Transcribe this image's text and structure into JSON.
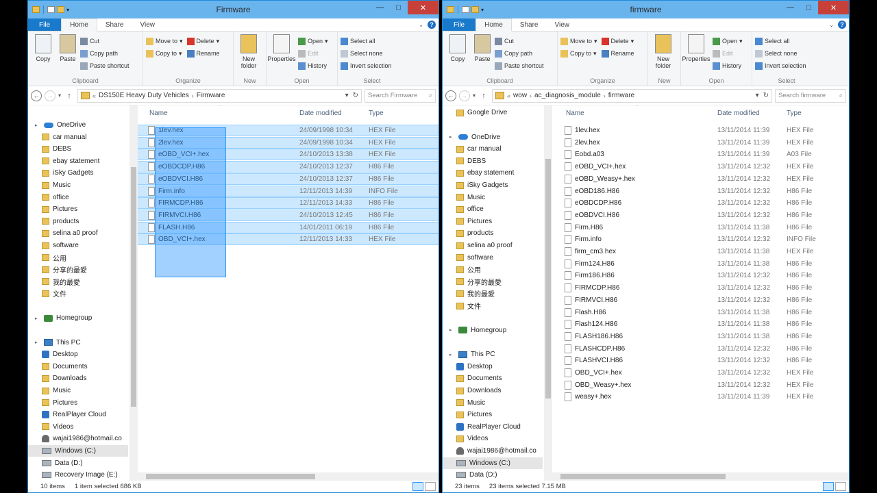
{
  "ribbon": {
    "tabs": [
      "File",
      "Home",
      "Share",
      "View"
    ],
    "clipboard": {
      "copy": "Copy",
      "paste": "Paste",
      "cut": "Cut",
      "copy_path": "Copy path",
      "paste_shortcut": "Paste shortcut",
      "label": "Clipboard"
    },
    "organize": {
      "move_to": "Move to",
      "copy_to": "Copy to",
      "delete": "Delete",
      "rename": "Rename",
      "label": "Organize"
    },
    "new": {
      "new_folder": "New folder",
      "label": "New"
    },
    "open": {
      "properties": "Properties",
      "open": "Open",
      "edit": "Edit",
      "history": "History",
      "label": "Open"
    },
    "select": {
      "select_all": "Select all",
      "select_none": "Select none",
      "invert": "Invert selection",
      "label": "Select"
    }
  },
  "columns": {
    "name": "Name",
    "date": "Date modified",
    "type": "Type"
  },
  "left": {
    "title": "Firmware",
    "breadcrumb": [
      "DS150E Heavy Duty Vehicles",
      "Firmware"
    ],
    "search_placeholder": "Search Firmware",
    "nav": [
      {
        "label": "OneDrive",
        "icon": "cloud-icon",
        "kind": "root"
      },
      {
        "label": "car manual",
        "icon": "folder-icon"
      },
      {
        "label": "DEBS",
        "icon": "folder-icon"
      },
      {
        "label": "ebay statement",
        "icon": "folder-icon"
      },
      {
        "label": "iSky Gadgets",
        "icon": "folder-icon"
      },
      {
        "label": "Music",
        "icon": "folder-icon"
      },
      {
        "label": "office",
        "icon": "folder-icon"
      },
      {
        "label": "Pictures",
        "icon": "folder-icon"
      },
      {
        "label": "products",
        "icon": "folder-icon"
      },
      {
        "label": "selina a0 proof",
        "icon": "folder-icon"
      },
      {
        "label": "software",
        "icon": "folder-icon"
      },
      {
        "label": "公用",
        "icon": "folder-icon"
      },
      {
        "label": "分享的最愛",
        "icon": "folder-icon"
      },
      {
        "label": "我的最愛",
        "icon": "folder-icon"
      },
      {
        "label": "文件",
        "icon": "folder-icon"
      },
      {
        "label": "Homegroup",
        "icon": "homegroup-icon",
        "kind": "root"
      },
      {
        "label": "This PC",
        "icon": "pc-icon",
        "kind": "root"
      },
      {
        "label": "Desktop",
        "icon": "desktop-icon"
      },
      {
        "label": "Documents",
        "icon": "folder-icon"
      },
      {
        "label": "Downloads",
        "icon": "folder-icon"
      },
      {
        "label": "Music",
        "icon": "folder-icon"
      },
      {
        "label": "Pictures",
        "icon": "folder-icon"
      },
      {
        "label": "RealPlayer Cloud",
        "icon": "realplayer-icon"
      },
      {
        "label": "Videos",
        "icon": "folder-icon"
      },
      {
        "label": "wajai1986@hotmail.co",
        "icon": "user-icon"
      },
      {
        "label": "Windows (C:)",
        "icon": "drive-icon",
        "selected": true
      },
      {
        "label": "Data (D:)",
        "icon": "drive-icon"
      },
      {
        "label": "Recovery Image (E:)",
        "icon": "drive-icon"
      }
    ],
    "files": [
      {
        "name": "1lev.hex",
        "date": "24/09/1998 10:34",
        "type": "HEX File"
      },
      {
        "name": "2lev.hex",
        "date": "24/09/1998 10:34",
        "type": "HEX File"
      },
      {
        "name": "eOBD_VCI+.hex",
        "date": "24/10/2013 13:38",
        "type": "HEX File"
      },
      {
        "name": "eOBDCDP.H86",
        "date": "24/10/2013 12:37",
        "type": "H86 File"
      },
      {
        "name": "eOBDVCI.H86",
        "date": "24/10/2013 12:37",
        "type": "H86 File"
      },
      {
        "name": "Firm.info",
        "date": "12/11/2013 14:39",
        "type": "INFO File"
      },
      {
        "name": "FIRMCDP.H86",
        "date": "12/11/2013 14:33",
        "type": "H86 File"
      },
      {
        "name": "FIRMVCI.H86",
        "date": "24/10/2013 12:45",
        "type": "H86 File"
      },
      {
        "name": "FLASH.H86",
        "date": "14/01/2011 06:19",
        "type": "H86 File"
      },
      {
        "name": "OBD_VCI+.hex",
        "date": "12/11/2013 14:33",
        "type": "HEX File"
      }
    ],
    "status": {
      "items": "10 items",
      "selected": "1 item selected  686 KB"
    }
  },
  "right": {
    "title": "firmware",
    "breadcrumb": [
      "wow",
      "ac_diagnosis_module",
      "firmware"
    ],
    "search_placeholder": "Search firmware",
    "nav": [
      {
        "label": "Google Drive",
        "icon": "folder-icon"
      },
      {
        "label": "OneDrive",
        "icon": "cloud-icon",
        "kind": "root"
      },
      {
        "label": "car manual",
        "icon": "folder-icon"
      },
      {
        "label": "DEBS",
        "icon": "folder-icon"
      },
      {
        "label": "ebay statement",
        "icon": "folder-icon"
      },
      {
        "label": "iSky Gadgets",
        "icon": "folder-icon"
      },
      {
        "label": "Music",
        "icon": "folder-icon"
      },
      {
        "label": "office",
        "icon": "folder-icon"
      },
      {
        "label": "Pictures",
        "icon": "folder-icon"
      },
      {
        "label": "products",
        "icon": "folder-icon"
      },
      {
        "label": "selina a0 proof",
        "icon": "folder-icon"
      },
      {
        "label": "software",
        "icon": "folder-icon"
      },
      {
        "label": "公用",
        "icon": "folder-icon"
      },
      {
        "label": "分享的最愛",
        "icon": "folder-icon"
      },
      {
        "label": "我的最愛",
        "icon": "folder-icon"
      },
      {
        "label": "文件",
        "icon": "folder-icon"
      },
      {
        "label": "Homegroup",
        "icon": "homegroup-icon",
        "kind": "root"
      },
      {
        "label": "This PC",
        "icon": "pc-icon",
        "kind": "root"
      },
      {
        "label": "Desktop",
        "icon": "desktop-icon"
      },
      {
        "label": "Documents",
        "icon": "folder-icon"
      },
      {
        "label": "Downloads",
        "icon": "folder-icon"
      },
      {
        "label": "Music",
        "icon": "folder-icon"
      },
      {
        "label": "Pictures",
        "icon": "folder-icon"
      },
      {
        "label": "RealPlayer Cloud",
        "icon": "realplayer-icon"
      },
      {
        "label": "Videos",
        "icon": "folder-icon"
      },
      {
        "label": "wajai1986@hotmail.co",
        "icon": "user-icon"
      },
      {
        "label": "Windows (C:)",
        "icon": "drive-icon",
        "selected": true
      },
      {
        "label": "Data (D:)",
        "icon": "drive-icon"
      }
    ],
    "files": [
      {
        "name": "1lev.hex",
        "date": "13/11/2014 11:39",
        "type": "HEX File"
      },
      {
        "name": "2lev.hex",
        "date": "13/11/2014 11:39",
        "type": "HEX File"
      },
      {
        "name": "Eobd.a03",
        "date": "13/11/2014 11:39",
        "type": "A03 File"
      },
      {
        "name": "eOBD_VCI+.hex",
        "date": "13/11/2014 12:32",
        "type": "HEX File"
      },
      {
        "name": "eOBD_Weasy+.hex",
        "date": "13/11/2014 12:32",
        "type": "HEX File"
      },
      {
        "name": "eOBD186.H86",
        "date": "13/11/2014 12:32",
        "type": "H86 File"
      },
      {
        "name": "eOBDCDP.H86",
        "date": "13/11/2014 12:32",
        "type": "H86 File"
      },
      {
        "name": "eOBDVCI.H86",
        "date": "13/11/2014 12:32",
        "type": "H86 File"
      },
      {
        "name": "Firm.H86",
        "date": "13/11/2014 11:38",
        "type": "H86 File"
      },
      {
        "name": "Firm.info",
        "date": "13/11/2014 12:32",
        "type": "INFO File"
      },
      {
        "name": "firm_cm3.hex",
        "date": "13/11/2014 11:38",
        "type": "HEX File"
      },
      {
        "name": "Firm124.H86",
        "date": "13/11/2014 11:38",
        "type": "H86 File"
      },
      {
        "name": "Firm186.H86",
        "date": "13/11/2014 12:32",
        "type": "H86 File"
      },
      {
        "name": "FIRMCDP.H86",
        "date": "13/11/2014 12:32",
        "type": "H86 File"
      },
      {
        "name": "FIRMVCI.H86",
        "date": "13/11/2014 12:32",
        "type": "H86 File"
      },
      {
        "name": "Flash.H86",
        "date": "13/11/2014 11:38",
        "type": "H86 File"
      },
      {
        "name": "Flash124.H86",
        "date": "13/11/2014 11:38",
        "type": "H86 File"
      },
      {
        "name": "FLASH186.H86",
        "date": "13/11/2014 11:38",
        "type": "H86 File"
      },
      {
        "name": "FLASHCDP.H86",
        "date": "13/11/2014 12:32",
        "type": "H86 File"
      },
      {
        "name": "FLASHVCI.H86",
        "date": "13/11/2014 12:32",
        "type": "H86 File"
      },
      {
        "name": "OBD_VCI+.hex",
        "date": "13/11/2014 12:32",
        "type": "HEX File"
      },
      {
        "name": "OBD_Weasy+.hex",
        "date": "13/11/2014 12:32",
        "type": "HEX File"
      },
      {
        "name": "weasy+.hex",
        "date": "13/11/2014 11:39",
        "type": "HEX File"
      }
    ],
    "status": {
      "items": "23 items",
      "selected": "23 items selected  7.15 MB"
    }
  }
}
